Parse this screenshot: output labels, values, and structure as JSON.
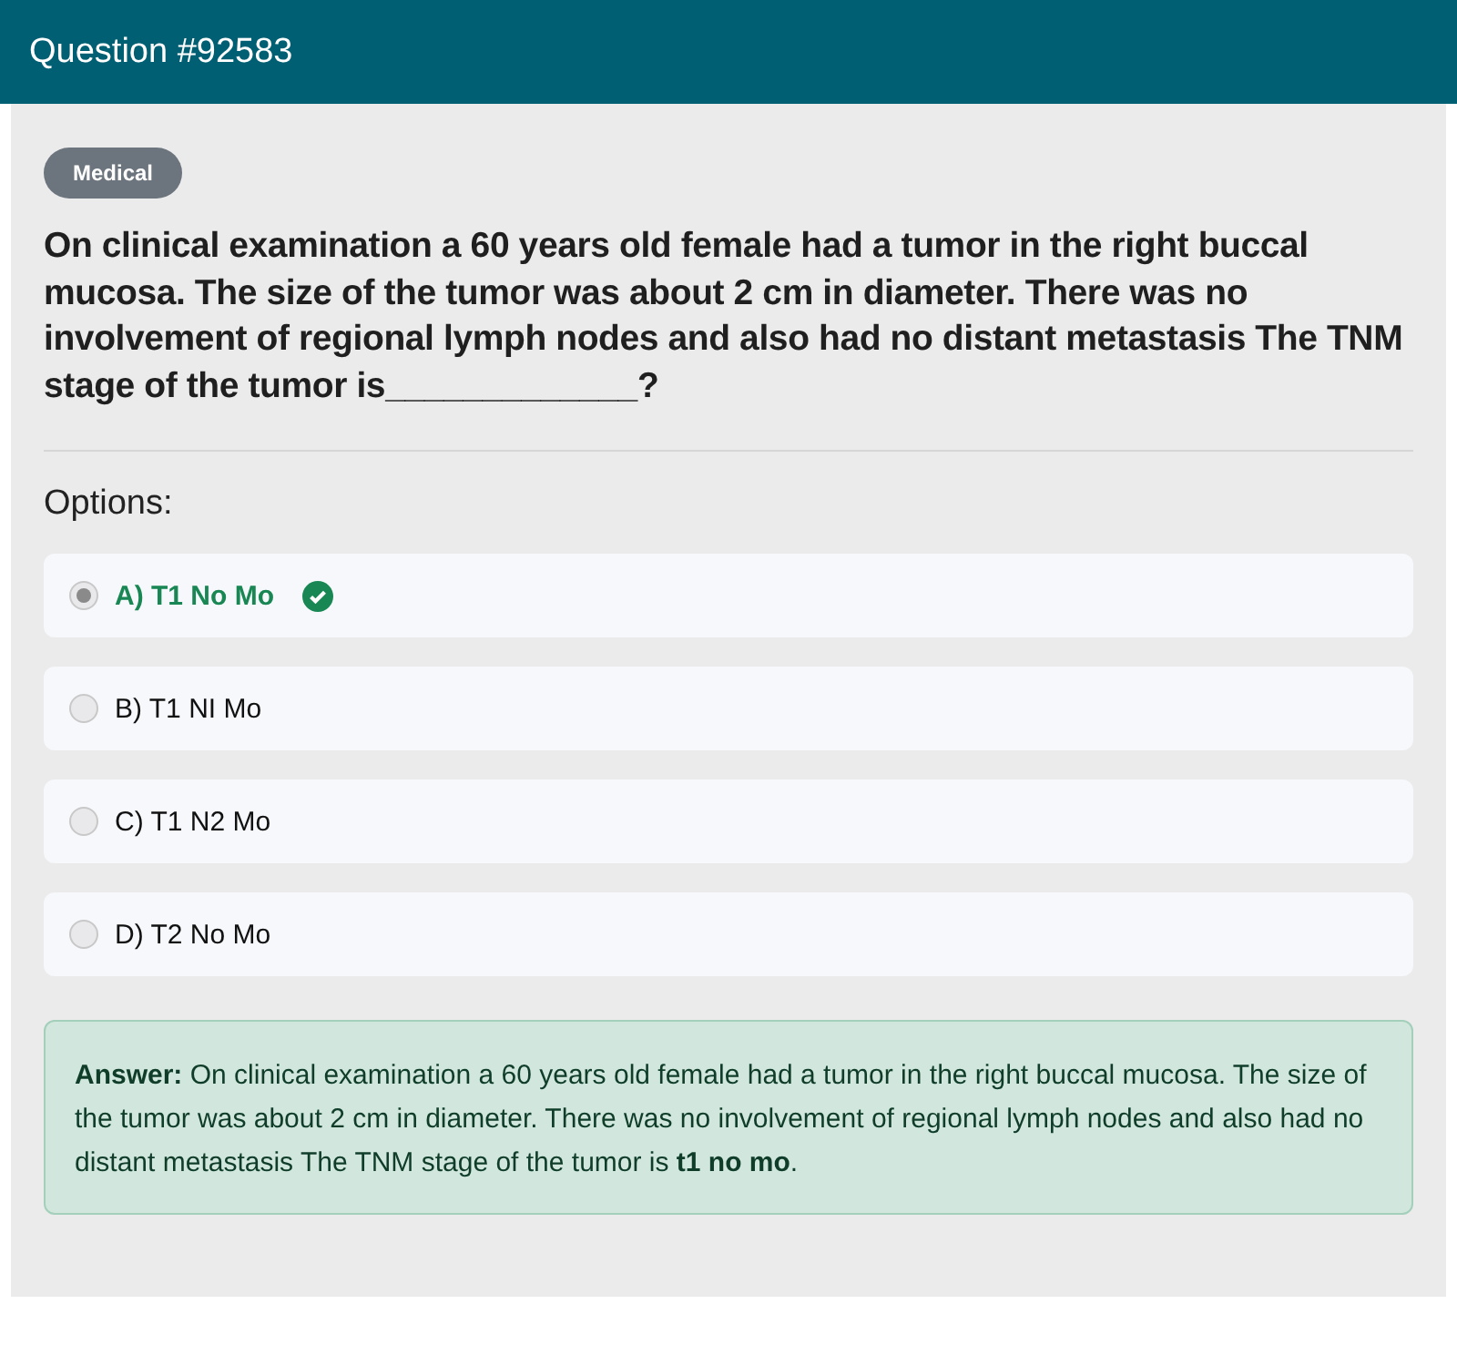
{
  "header": {
    "title": "Question #92583"
  },
  "category": "Medical",
  "question": "On clinical examination a 60 years old female had a tumor in the right buccal mucosa. The size of the tumor was about 2 cm in diameter. There was no involvement of regional lymph nodes and also had no distant metastasis The TNM stage of the tumor is_____________?",
  "options_label": "Options:",
  "options": [
    {
      "label": "A) T1 No Mo",
      "selected": true,
      "correct": true
    },
    {
      "label": "B) T1 NI Mo",
      "selected": false,
      "correct": false
    },
    {
      "label": "C) T1 N2 Mo",
      "selected": false,
      "correct": false
    },
    {
      "label": "D) T2 No Mo",
      "selected": false,
      "correct": false
    }
  ],
  "answer": "**Answer:** On clinical examination a 60 years old female had a tumor in the right buccal mucosa. The size of the tumor was about 2 cm in diameter. There was no involvement of regional lymph nodes and also had no distant metastasis The TNM stage of the tumor is **t1 no mo**."
}
